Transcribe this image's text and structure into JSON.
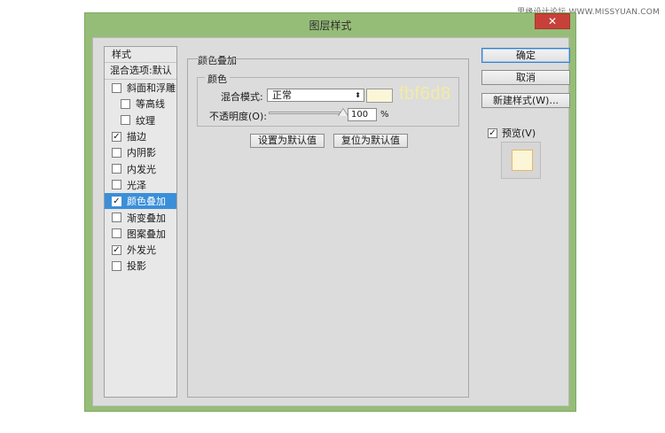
{
  "watermark": "思缘设计论坛 WWW.MISSYUAN.COM",
  "window": {
    "title": "图层样式",
    "close_glyph": "✕"
  },
  "styles_panel": {
    "header": "样式",
    "blend_options": "混合选项:默认",
    "items": [
      {
        "label": "斜面和浮雕",
        "checked": false,
        "sub": false
      },
      {
        "label": "等高线",
        "checked": false,
        "sub": true
      },
      {
        "label": "纹理",
        "checked": false,
        "sub": true
      },
      {
        "label": "描边",
        "checked": true,
        "sub": false
      },
      {
        "label": "内阴影",
        "checked": false,
        "sub": false
      },
      {
        "label": "内发光",
        "checked": false,
        "sub": false
      },
      {
        "label": "光泽",
        "checked": false,
        "sub": false
      },
      {
        "label": "颜色叠加",
        "checked": true,
        "sub": false,
        "active": true
      },
      {
        "label": "渐变叠加",
        "checked": false,
        "sub": false
      },
      {
        "label": "图案叠加",
        "checked": false,
        "sub": false
      },
      {
        "label": "外发光",
        "checked": true,
        "sub": false
      },
      {
        "label": "投影",
        "checked": false,
        "sub": false
      }
    ]
  },
  "color_overlay": {
    "section_title": "颜色叠加",
    "group_title": "颜色",
    "blend_mode_label": "混合模式:",
    "blend_mode_value": "正常",
    "color_hex": "#fbf6d8",
    "hex_label": "fbf6d8",
    "opacity_label": "不透明度(O):",
    "opacity_value": "100",
    "opacity_unit": "%",
    "opacity_fraction": 1.0,
    "make_default": "设置为默认值",
    "reset_default": "复位为默认值"
  },
  "actions": {
    "ok": "确定",
    "cancel": "取消",
    "new_style": "新建样式(W)...",
    "preview_label": "预览(V)",
    "preview_checked": true
  },
  "colors": {
    "window_frame": "#96bd78",
    "dialog_bg": "#dcdcdc",
    "selection": "#3b8fd8",
    "close_button": "#c7413a",
    "overlay_color": "#fbf6d8",
    "preview_border": "#e7b866"
  }
}
